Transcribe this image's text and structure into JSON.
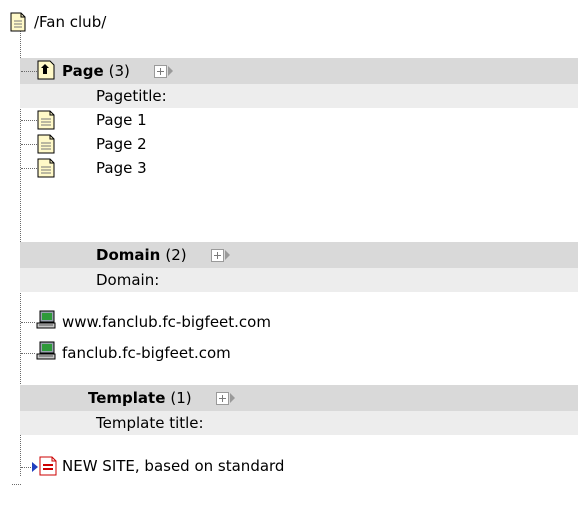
{
  "path": "/Fan club/",
  "sections": [
    {
      "title": "Page",
      "count": "(3)",
      "field_label": "Pagetitle:",
      "items": [
        "Page 1",
        "Page 2",
        "Page 3"
      ]
    },
    {
      "title": "Domain",
      "count": "(2)",
      "field_label": "Domain:",
      "items": [
        "www.fanclub.fc-bigfeet.com",
        "fanclub.fc-bigfeet.com"
      ]
    },
    {
      "title": "Template",
      "count": "(1)",
      "field_label": "Template title:",
      "items": [
        "NEW SITE, based on standard"
      ]
    }
  ],
  "icons": {
    "path": "page-icon",
    "page_section": "page-up-icon",
    "page_item": "page-icon",
    "domain_item": "computer-icon",
    "template_item": "template-icon",
    "expand": "plus-expand-icon"
  },
  "colors": {
    "header_band": "#d9d9d9",
    "sub_band": "#ededed",
    "icon_yellow": "#fff9c8",
    "template_red": "#cc0000",
    "arrow_blue": "#1f3fbf"
  }
}
